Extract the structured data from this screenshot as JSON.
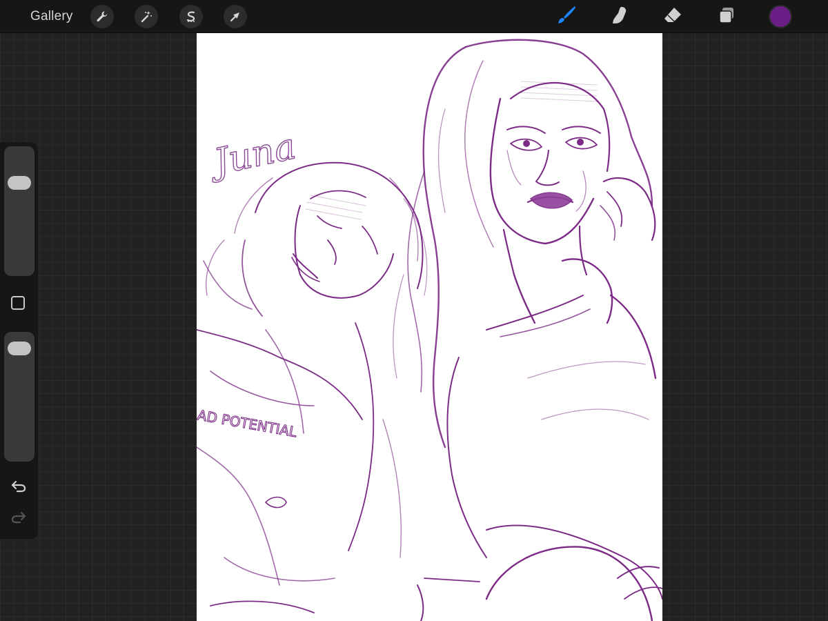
{
  "app": {
    "gallery_label": "Gallery"
  },
  "toolbar_left": [
    {
      "name": "actions",
      "icon": "wrench-icon"
    },
    {
      "name": "adjustments",
      "icon": "magic-wand-icon"
    },
    {
      "name": "selection",
      "icon": "selection-s-icon"
    },
    {
      "name": "transform",
      "icon": "arrow-cursor-icon"
    }
  ],
  "toolbar_right": [
    {
      "name": "brush",
      "icon": "brush-icon",
      "active": true
    },
    {
      "name": "smudge",
      "icon": "smudge-finger-icon",
      "active": false
    },
    {
      "name": "eraser",
      "icon": "eraser-icon",
      "active": false
    },
    {
      "name": "layers",
      "icon": "layers-icon",
      "active": false
    }
  ],
  "current_color": "#6b1f86",
  "accent_color": "#1e86ff",
  "canvas": {
    "signature_text": "Juna",
    "shirt_text": "AD POTENTIAL",
    "stroke_color": "#7b2a86"
  },
  "sidebar": {
    "brush_size_level": 0.76,
    "opacity_level": 0.95,
    "undo_icon": "undo-arrow-icon",
    "redo_icon": "redo-arrow-icon"
  }
}
